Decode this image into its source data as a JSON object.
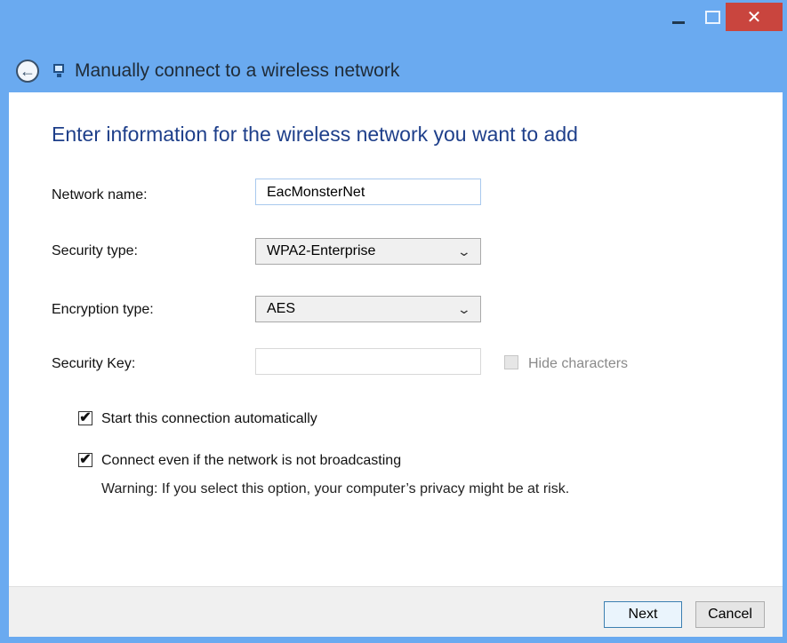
{
  "titlebar": {
    "minimize_icon": "minimize-icon",
    "maximize_icon": "maximize-icon",
    "close_icon": "close-icon",
    "close_glyph": "✕"
  },
  "header": {
    "back_icon": "back-arrow-icon",
    "back_glyph": "←",
    "network_icon": "network-icon",
    "title": "Manually connect to a wireless network"
  },
  "main": {
    "heading": "Enter information for the wireless network you want to add",
    "network_name": {
      "label": "Network name:",
      "value": "EacMonsterNet"
    },
    "security_type": {
      "label": "Security type:",
      "value": "WPA2-Enterprise"
    },
    "encryption_type": {
      "label": "Encryption type:",
      "value": "AES"
    },
    "security_key": {
      "label": "Security Key:",
      "value": "",
      "hide_characters": "Hide characters"
    },
    "options": {
      "start_auto": {
        "label": "Start this connection automatically",
        "checked": true,
        "glyph": "✔"
      },
      "connect_broadcasting": {
        "label": "Connect even if the network is not broadcasting",
        "checked": true,
        "glyph": "✔"
      }
    },
    "warning": "Warning: If you select this option, your computer’s privacy might be at risk."
  },
  "footer": {
    "next": "Next",
    "cancel": "Cancel"
  },
  "colors": {
    "title_bar": "#6aaaf0",
    "close_button": "#c9453e",
    "heading": "#1e3f8a"
  }
}
